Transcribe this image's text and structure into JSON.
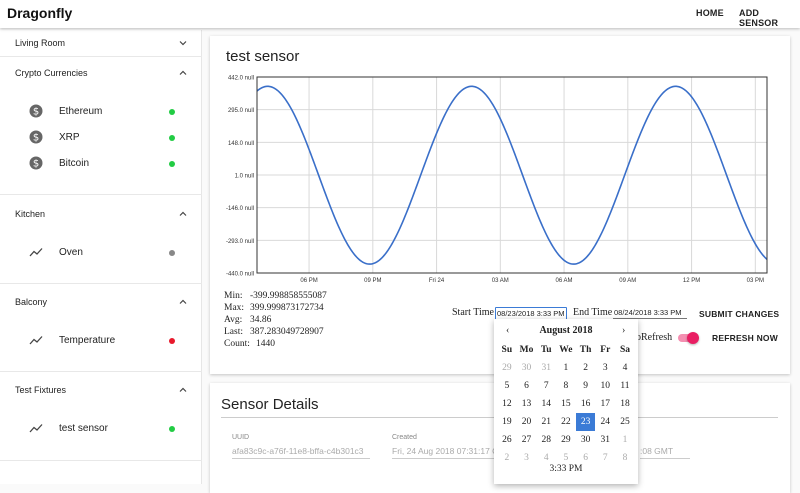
{
  "app": {
    "title": "Dragonfly"
  },
  "nav": {
    "home": "HOME",
    "add_sensor": "ADD SENSOR"
  },
  "sidebar": {
    "groups": [
      {
        "label": "Living Room",
        "expanded": false,
        "items": []
      },
      {
        "label": "Crypto Currencies",
        "expanded": true,
        "items": [
          {
            "label": "Ethereum",
            "icon": "dollar-icon",
            "status": "#22cc44"
          },
          {
            "label": "XRP",
            "icon": "dollar-icon",
            "status": "#22cc44"
          },
          {
            "label": "Bitcoin",
            "icon": "dollar-icon",
            "status": "#22cc44"
          }
        ]
      },
      {
        "label": "Kitchen",
        "expanded": true,
        "items": [
          {
            "label": "Oven",
            "icon": "trend-icon",
            "status": "#888888"
          }
        ]
      },
      {
        "label": "Balcony",
        "expanded": true,
        "items": [
          {
            "label": "Temperature",
            "icon": "trend-icon",
            "status": "#e8192c"
          }
        ]
      },
      {
        "label": "Test Fixtures",
        "expanded": true,
        "items": [
          {
            "label": "test sensor",
            "icon": "trend-icon",
            "status": "#22cc44"
          }
        ]
      }
    ]
  },
  "sensor": {
    "title": "test sensor",
    "stats": [
      {
        "k": "Min:",
        "v": "-399.998858555087"
      },
      {
        "k": "Max:",
        "v": "399.999873172734"
      },
      {
        "k": "Avg:",
        "v": "34.86"
      },
      {
        "k": "Last:",
        "v": "387.283049728907"
      },
      {
        "k": "Count:",
        "v": "1440"
      }
    ],
    "start_label": "Start Time",
    "start_value": "08/23/2018 3:33 PM",
    "end_label": "End Time",
    "end_value": "08/24/2018 3:33 PM",
    "submit": "SUBMIT CHANGES",
    "auto_refresh_label": "oRefresh",
    "auto_refresh_on": true,
    "refresh_now": "REFRESH NOW"
  },
  "chart_data": {
    "type": "line",
    "y_tick_labels": [
      "442.0 null",
      "295.0 null",
      "148.0 null",
      "1.0 null",
      "-146.0 null",
      "-293.0 null",
      "-440.0 null"
    ],
    "y_ticks": [
      442,
      295,
      148,
      1,
      -146,
      -293,
      -440
    ],
    "ylim": [
      -440,
      442
    ],
    "x_tick_labels": [
      "06 PM",
      "09 PM",
      "Fri 24",
      "03 AM",
      "06 AM",
      "09 AM",
      "12 PM",
      "03 PM"
    ],
    "x_ticks_hours": [
      2.45,
      5.45,
      8.45,
      11.45,
      14.45,
      17.45,
      20.45,
      23.45
    ],
    "xlim_hours": [
      0,
      24
    ],
    "series": [
      {
        "amplitude": 400,
        "period_hours": 9.6,
        "peak_hours": [
          0.5,
          10.1,
          19.7
        ],
        "color": "#3a6fc9"
      }
    ],
    "grid": true,
    "legend": "none"
  },
  "datepicker": {
    "month": "August 2018",
    "prev": "‹",
    "next": "›",
    "weekdays": [
      "Su",
      "Mo",
      "Tu",
      "We",
      "Th",
      "Fr",
      "Sa"
    ],
    "weeks": [
      [
        "29",
        "30",
        "31",
        "1",
        "2",
        "3",
        "4"
      ],
      [
        "5",
        "6",
        "7",
        "8",
        "9",
        "10",
        "11"
      ],
      [
        "12",
        "13",
        "14",
        "15",
        "16",
        "17",
        "18"
      ],
      [
        "19",
        "20",
        "21",
        "22",
        "23",
        "24",
        "25"
      ],
      [
        "26",
        "27",
        "28",
        "29",
        "30",
        "31",
        "1"
      ],
      [
        "2",
        "3",
        "4",
        "5",
        "6",
        "7",
        "8"
      ]
    ],
    "muted": [
      [
        0,
        0
      ],
      [
        0,
        1
      ],
      [
        0,
        2
      ],
      [
        4,
        6
      ],
      [
        5,
        0
      ],
      [
        5,
        1
      ],
      [
        5,
        2
      ],
      [
        5,
        3
      ],
      [
        5,
        4
      ],
      [
        5,
        5
      ],
      [
        5,
        6
      ]
    ],
    "selected": [
      3,
      4
    ],
    "time": "3:33 PM"
  },
  "details": {
    "title": "Sensor Details",
    "uuid_label": "UUID",
    "uuid_value": "afa83c9c-a76f-11e8-bffa-c4b301c3",
    "created_label": "Created",
    "created_value": "Fri, 24 Aug 2018 07:31:17 G",
    "tail_value": ":08 GMT"
  }
}
